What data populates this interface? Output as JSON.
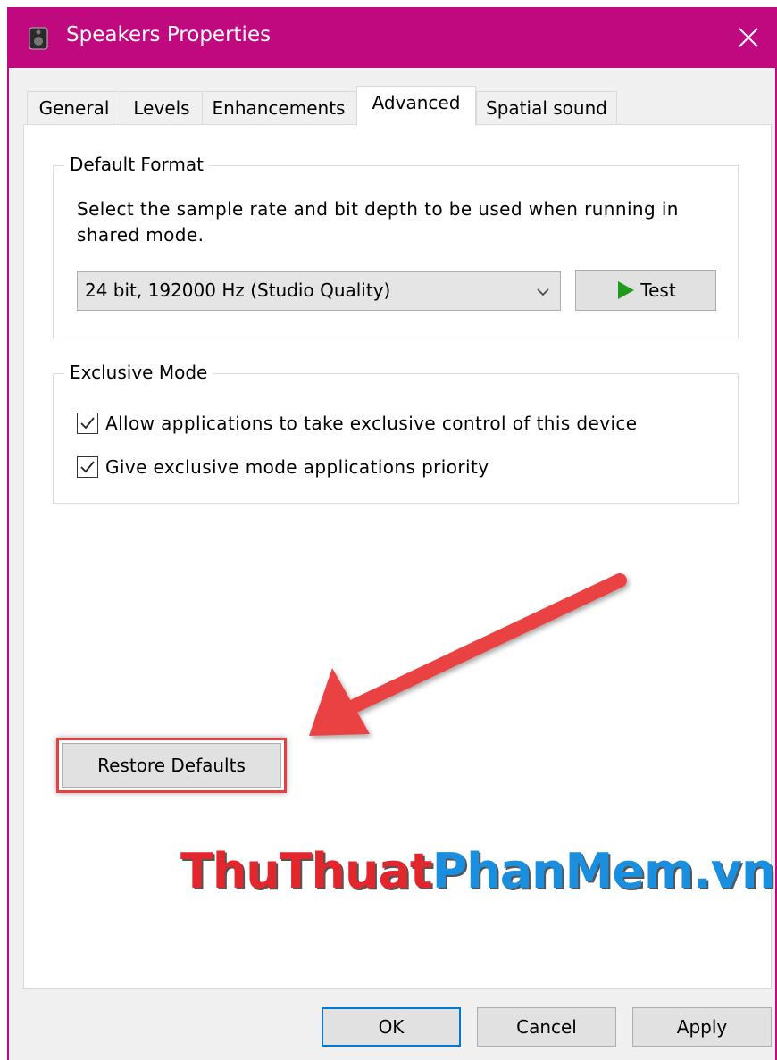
{
  "window": {
    "title": "Speakers Properties"
  },
  "tabs": [
    {
      "label": "General"
    },
    {
      "label": "Levels"
    },
    {
      "label": "Enhancements"
    },
    {
      "label": "Advanced"
    },
    {
      "label": "Spatial sound"
    }
  ],
  "default_format": {
    "legend": "Default Format",
    "description": "Select the sample rate and bit depth to be used when running in shared mode.",
    "selected_format": "24 bit, 192000 Hz (Studio Quality)",
    "test_label": "Test"
  },
  "exclusive_mode": {
    "legend": "Exclusive Mode",
    "options": [
      {
        "label": "Allow applications to take exclusive control of this device",
        "checked": true
      },
      {
        "label": "Give exclusive mode applications priority",
        "checked": true
      }
    ]
  },
  "restore_defaults_label": "Restore Defaults",
  "watermark": {
    "part1": "ThuThuat",
    "part2": "PhanMem.vn"
  },
  "footer": {
    "ok_label": "OK",
    "cancel_label": "Cancel",
    "apply_label": "Apply"
  },
  "colors": {
    "titlebar": "#c0087f",
    "highlight": "#e8403f",
    "play": "#1f9a1f"
  }
}
